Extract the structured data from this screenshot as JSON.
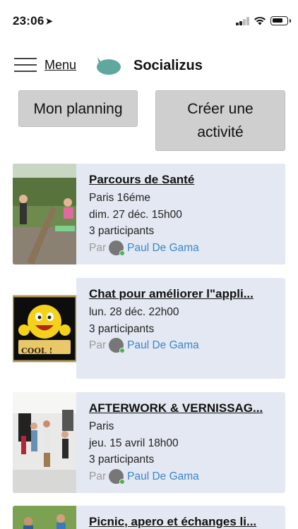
{
  "status_bar": {
    "time": "23:06",
    "location_arrow": "➤"
  },
  "header": {
    "menu_label": "Menu",
    "app_title": "Socializus",
    "logo_color": "#5fa8a0"
  },
  "actions": {
    "planning_label": "Mon planning",
    "create_label_line1": "Créer une",
    "create_label_line2": "activité"
  },
  "activities": [
    {
      "title": "Parcours de Santé",
      "location": "Paris 16éme",
      "date": "dim. 27 déc. 15h00",
      "participants": "3 participants",
      "by_label": "Par",
      "author": "Paul De Gama"
    },
    {
      "title": "Chat pour améliorer l\"appli...",
      "date": "lun. 28 déc. 22h00",
      "participants": "3 participants",
      "by_label": "Par",
      "author": "Paul De Gama",
      "badge_text": "COOL !"
    },
    {
      "title": "AFTERWORK & VERNISSAG...",
      "location": "Paris",
      "date": "jeu. 15 avril 18h00",
      "participants": "3 participants",
      "by_label": "Par",
      "author": "Paul De Gama"
    },
    {
      "title": "Picnic, apero et échanges li..."
    }
  ],
  "colors": {
    "card_bg": "#e4e8f2",
    "button_bg": "#cfcfcf",
    "author_link": "#3b86c9",
    "online_dot": "#4cb44c"
  }
}
